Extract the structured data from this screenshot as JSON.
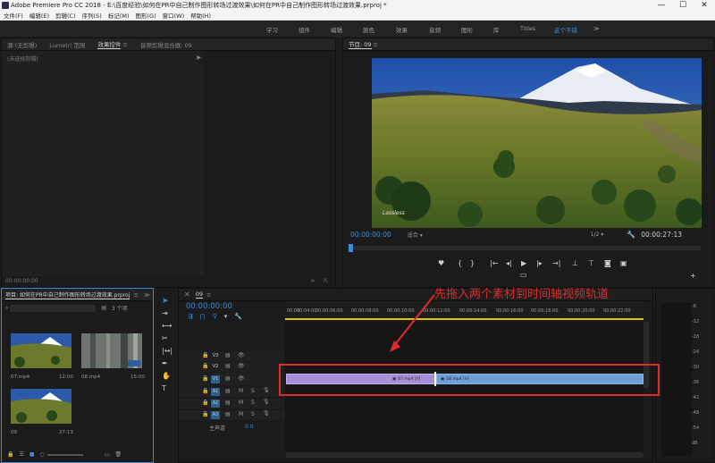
{
  "window": {
    "title": "Adobe Premiere Pro CC 2018 - E:\\百度经验\\如何在PR中自己制作图形转场过渡效果\\如何在PR中自己制作图形转场过渡效果.prproj *",
    "minimize": "—",
    "maximize": "☐",
    "close": "✕"
  },
  "menu": [
    "文件(F)",
    "编辑(E)",
    "剪辑(C)",
    "序列(S)",
    "标记(M)",
    "图形(G)",
    "窗口(W)",
    "帮助(H)"
  ],
  "workspaces": [
    "学习",
    "组件",
    "编辑",
    "颜色",
    "效果",
    "音频",
    "图形",
    "库",
    "Titles",
    "这个不错"
  ],
  "workspace_active_index": 9,
  "source_panel": {
    "tabs": [
      "源:(无剪辑)",
      "Lumetri 范围",
      "效果控件",
      "音频剪辑混合器: 09"
    ],
    "active_tab_index": 2,
    "no_clip_label": "(未选择剪辑)",
    "timecode": "00:00:00:00"
  },
  "program": {
    "tab": "节目: 09",
    "timecode": "00:00:00:00",
    "fit": "适合",
    "resolution": "1/2",
    "duration": "00:00:27:13",
    "watermark": "Lossless"
  },
  "project": {
    "tab": "项目: 如何在PR中自己制作图形转场过渡效果.prproj",
    "item_count": "3 个项",
    "items": [
      {
        "name": "07.mp4",
        "duration": "12:00"
      },
      {
        "name": "08.mp4",
        "duration": "15:00"
      },
      {
        "name": "09",
        "duration": "27:13"
      }
    ]
  },
  "timeline": {
    "tab": "09",
    "timecode": "00:00:00:00",
    "ruler": [
      "00:00",
      "00:04:00",
      "00:00:06:00",
      "00:00:08:00",
      "00:00:10:00",
      "00:00:12:00",
      "00:00:14:00",
      "00:00:16:00",
      "00:00:18:00",
      "00:00:20:00",
      "00:00:22:00"
    ],
    "video_tracks": [
      "V3",
      "V2",
      "V1"
    ],
    "audio_tracks": [
      "A1",
      "A2",
      "A3"
    ],
    "master": "主声道",
    "master_value": "0.0",
    "mute": "M",
    "solo": "S",
    "clips": [
      {
        "name": "07.mp4 [V]",
        "color": "#a890d8"
      },
      {
        "name": "08.mp4 [V]",
        "color": "#6a9fd8"
      }
    ]
  },
  "annotation": {
    "text": "先拖入两个素材到时间轴视频轨道",
    "color": "#e02b2b"
  },
  "meter_labels": [
    "-6",
    "-12",
    "-18",
    "-24",
    "-30",
    "-36",
    "-42",
    "-48",
    "-54",
    "dB"
  ]
}
